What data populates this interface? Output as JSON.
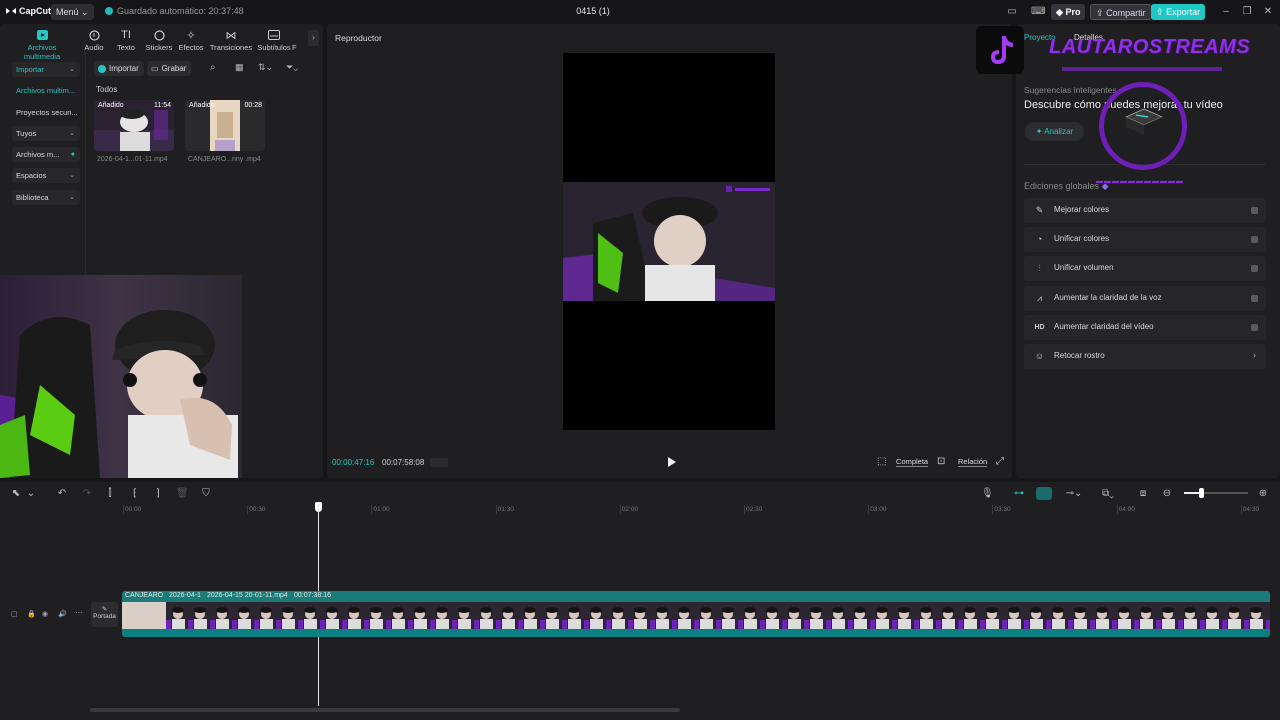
{
  "app": {
    "logo": "CapCut",
    "menu_label": "Menú",
    "autosave": "Guardado automático: 20:37:48",
    "project_title": "0415 (1)",
    "pro_label": "Pro",
    "share_label": "Compartir",
    "export_label": "Exportar"
  },
  "toolbar": {
    "tabs": [
      {
        "label": "Archivos multimedia",
        "icon": "media-icon"
      },
      {
        "label": "Audio",
        "icon": "audio-icon"
      },
      {
        "label": "Texto",
        "icon": "text-icon"
      },
      {
        "label": "Stickers",
        "icon": "sticker-icon"
      },
      {
        "label": "Efectos",
        "icon": "effects-icon"
      },
      {
        "label": "Transiciones",
        "icon": "transitions-icon"
      },
      {
        "label": "Subtítulos",
        "icon": "subtitles-icon"
      },
      {
        "label": "F"
      }
    ]
  },
  "media": {
    "sidebar": [
      {
        "label": "Importar"
      },
      {
        "label": "Archivos multim..."
      },
      {
        "label": "Proyectos secun..."
      },
      {
        "label": "Tuyos"
      },
      {
        "label": "Archivos m..."
      },
      {
        "label": "Espacios"
      },
      {
        "label": "Biblioteca"
      }
    ],
    "import_btn": "Importar",
    "record_btn": "Grabar",
    "filter_label": "Todos",
    "items": [
      {
        "badge": "Añadido",
        "duration": "11:54",
        "name": "2026-04-1...01-11.mp4"
      },
      {
        "badge": "Añadido",
        "duration": "00:28",
        "name": "CANJEARO...nny .mp4"
      }
    ]
  },
  "player": {
    "title": "Reproductor",
    "current_time": "00:00:47:16",
    "total_time": "00:07:58:08",
    "full_label": "Completa",
    "ratio_label": "Relación"
  },
  "right_panel": {
    "tab_project": "Proyecto",
    "tab_details": "Detalles",
    "suggestions_title": "Sugerencias inteligentes",
    "discover_text": "Descubre cómo puedes mejorar tu vídeo",
    "analyze_label": "Analizar",
    "globals_title": "Ediciones globales",
    "global_items": [
      {
        "label": "Mejorar colores",
        "icon": "enhance-colors-icon",
        "type": "toggle"
      },
      {
        "label": "Unificar colores",
        "icon": "unify-colors-icon",
        "type": "toggle"
      },
      {
        "label": "Unificar volumen",
        "icon": "unify-volume-icon",
        "type": "toggle"
      },
      {
        "label": "Aumentar la claridad de la voz",
        "icon": "voice-clarity-icon",
        "type": "toggle"
      },
      {
        "label": "Aumentar claridad del vídeo",
        "icon": "hd-icon",
        "type": "toggle"
      },
      {
        "label": "Retocar rostro",
        "icon": "face-retouch-icon",
        "type": "chevron"
      }
    ]
  },
  "overlay": {
    "stream_name": "LAUTAROSTREAMS"
  },
  "timeline": {
    "ruler": [
      "00:00",
      "00:30",
      "01:00",
      "01:30",
      "02:00",
      "02:30",
      "03:00",
      "03:30",
      "04:00",
      "04:30"
    ],
    "cover_label": "Portada",
    "clip_labels": [
      "CANJEARO",
      "2026-04-1",
      "2026-04-15 20-01-11.mp4",
      "00:07:38:16"
    ]
  },
  "colors": {
    "accent": "#27c6c2",
    "clip": "#0f5c5a",
    "stream_purple": "#8f2fe6"
  }
}
